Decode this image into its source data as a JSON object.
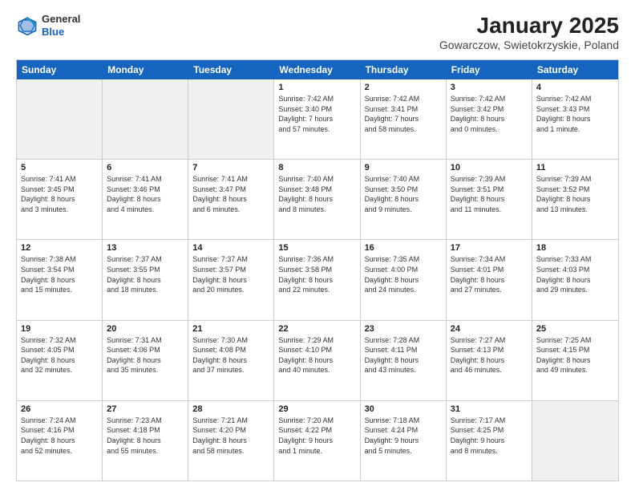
{
  "logo": {
    "general": "General",
    "blue": "Blue"
  },
  "title": "January 2025",
  "subtitle": "Gowarczow, Swietokrzyskie, Poland",
  "days": [
    "Sunday",
    "Monday",
    "Tuesday",
    "Wednesday",
    "Thursday",
    "Friday",
    "Saturday"
  ],
  "weeks": [
    [
      {
        "day": "",
        "content": ""
      },
      {
        "day": "",
        "content": ""
      },
      {
        "day": "",
        "content": ""
      },
      {
        "day": "1",
        "content": "Sunrise: 7:42 AM\nSunset: 3:40 PM\nDaylight: 7 hours\nand 57 minutes."
      },
      {
        "day": "2",
        "content": "Sunrise: 7:42 AM\nSunset: 3:41 PM\nDaylight: 7 hours\nand 58 minutes."
      },
      {
        "day": "3",
        "content": "Sunrise: 7:42 AM\nSunset: 3:42 PM\nDaylight: 8 hours\nand 0 minutes."
      },
      {
        "day": "4",
        "content": "Sunrise: 7:42 AM\nSunset: 3:43 PM\nDaylight: 8 hours\nand 1 minute."
      }
    ],
    [
      {
        "day": "5",
        "content": "Sunrise: 7:41 AM\nSunset: 3:45 PM\nDaylight: 8 hours\nand 3 minutes."
      },
      {
        "day": "6",
        "content": "Sunrise: 7:41 AM\nSunset: 3:46 PM\nDaylight: 8 hours\nand 4 minutes."
      },
      {
        "day": "7",
        "content": "Sunrise: 7:41 AM\nSunset: 3:47 PM\nDaylight: 8 hours\nand 6 minutes."
      },
      {
        "day": "8",
        "content": "Sunrise: 7:40 AM\nSunset: 3:48 PM\nDaylight: 8 hours\nand 8 minutes."
      },
      {
        "day": "9",
        "content": "Sunrise: 7:40 AM\nSunset: 3:50 PM\nDaylight: 8 hours\nand 9 minutes."
      },
      {
        "day": "10",
        "content": "Sunrise: 7:39 AM\nSunset: 3:51 PM\nDaylight: 8 hours\nand 11 minutes."
      },
      {
        "day": "11",
        "content": "Sunrise: 7:39 AM\nSunset: 3:52 PM\nDaylight: 8 hours\nand 13 minutes."
      }
    ],
    [
      {
        "day": "12",
        "content": "Sunrise: 7:38 AM\nSunset: 3:54 PM\nDaylight: 8 hours\nand 15 minutes."
      },
      {
        "day": "13",
        "content": "Sunrise: 7:37 AM\nSunset: 3:55 PM\nDaylight: 8 hours\nand 18 minutes."
      },
      {
        "day": "14",
        "content": "Sunrise: 7:37 AM\nSunset: 3:57 PM\nDaylight: 8 hours\nand 20 minutes."
      },
      {
        "day": "15",
        "content": "Sunrise: 7:36 AM\nSunset: 3:58 PM\nDaylight: 8 hours\nand 22 minutes."
      },
      {
        "day": "16",
        "content": "Sunrise: 7:35 AM\nSunset: 4:00 PM\nDaylight: 8 hours\nand 24 minutes."
      },
      {
        "day": "17",
        "content": "Sunrise: 7:34 AM\nSunset: 4:01 PM\nDaylight: 8 hours\nand 27 minutes."
      },
      {
        "day": "18",
        "content": "Sunrise: 7:33 AM\nSunset: 4:03 PM\nDaylight: 8 hours\nand 29 minutes."
      }
    ],
    [
      {
        "day": "19",
        "content": "Sunrise: 7:32 AM\nSunset: 4:05 PM\nDaylight: 8 hours\nand 32 minutes."
      },
      {
        "day": "20",
        "content": "Sunrise: 7:31 AM\nSunset: 4:06 PM\nDaylight: 8 hours\nand 35 minutes."
      },
      {
        "day": "21",
        "content": "Sunrise: 7:30 AM\nSunset: 4:08 PM\nDaylight: 8 hours\nand 37 minutes."
      },
      {
        "day": "22",
        "content": "Sunrise: 7:29 AM\nSunset: 4:10 PM\nDaylight: 8 hours\nand 40 minutes."
      },
      {
        "day": "23",
        "content": "Sunrise: 7:28 AM\nSunset: 4:11 PM\nDaylight: 8 hours\nand 43 minutes."
      },
      {
        "day": "24",
        "content": "Sunrise: 7:27 AM\nSunset: 4:13 PM\nDaylight: 8 hours\nand 46 minutes."
      },
      {
        "day": "25",
        "content": "Sunrise: 7:25 AM\nSunset: 4:15 PM\nDaylight: 8 hours\nand 49 minutes."
      }
    ],
    [
      {
        "day": "26",
        "content": "Sunrise: 7:24 AM\nSunset: 4:16 PM\nDaylight: 8 hours\nand 52 minutes."
      },
      {
        "day": "27",
        "content": "Sunrise: 7:23 AM\nSunset: 4:18 PM\nDaylight: 8 hours\nand 55 minutes."
      },
      {
        "day": "28",
        "content": "Sunrise: 7:21 AM\nSunset: 4:20 PM\nDaylight: 8 hours\nand 58 minutes."
      },
      {
        "day": "29",
        "content": "Sunrise: 7:20 AM\nSunset: 4:22 PM\nDaylight: 9 hours\nand 1 minute."
      },
      {
        "day": "30",
        "content": "Sunrise: 7:18 AM\nSunset: 4:24 PM\nDaylight: 9 hours\nand 5 minutes."
      },
      {
        "day": "31",
        "content": "Sunrise: 7:17 AM\nSunset: 4:25 PM\nDaylight: 9 hours\nand 8 minutes."
      },
      {
        "day": "",
        "content": ""
      }
    ]
  ]
}
